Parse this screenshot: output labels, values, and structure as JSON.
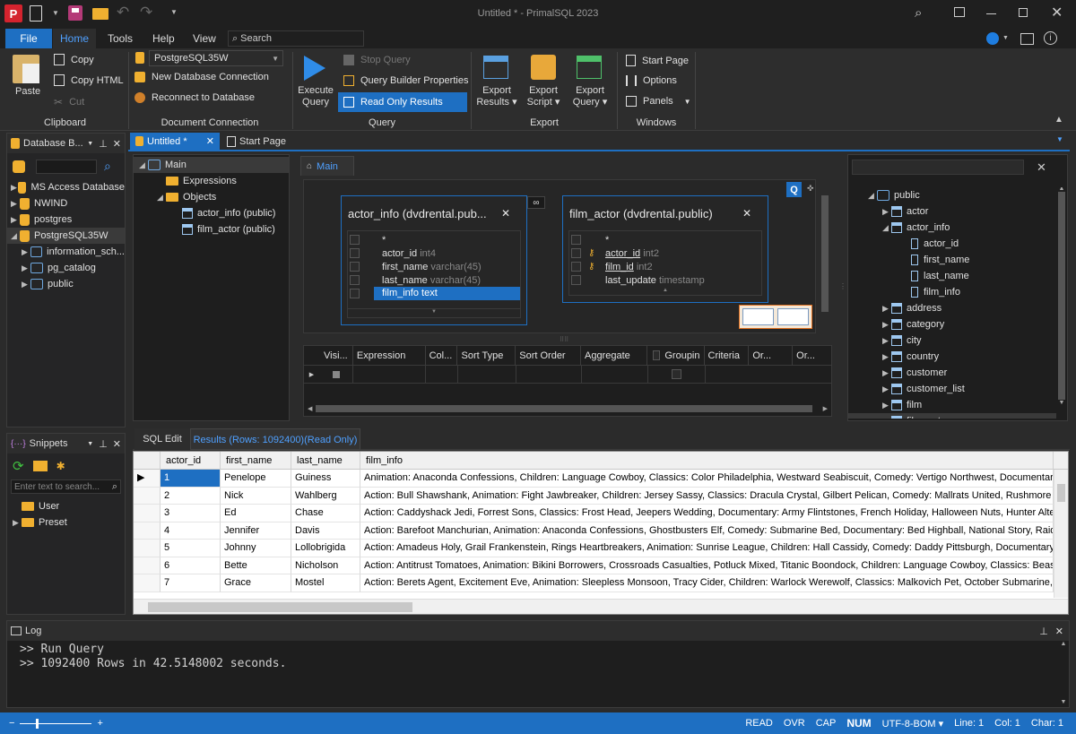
{
  "app": {
    "title": "Untitled * - PrimalSQL 2023"
  },
  "menu": {
    "file": "File",
    "home": "Home",
    "tools": "Tools",
    "help": "Help",
    "view": "View",
    "search_placeholder": "Search"
  },
  "ribbon": {
    "paste": "Paste",
    "copy": "Copy",
    "copy_html": "Copy HTML",
    "cut": "Cut",
    "clipboard": "Clipboard",
    "connection_select": "PostgreSQL35W",
    "new_connection": "New Database Connection",
    "reconnect": "Reconnect to Database",
    "doc_connection": "Document Connection",
    "execute_line1": "Execute",
    "execute_line2": "Query",
    "stop_query": "Stop Query",
    "qb_properties": "Query Builder Properties",
    "read_only": "Read Only Results",
    "query": "Query",
    "export_results_1": "Export",
    "export_results_2": "Results",
    "export_script_1": "Export",
    "export_script_2": "Script",
    "export_query_1": "Export",
    "export_query_2": "Query",
    "export": "Export",
    "start_page": "Start Page",
    "options": "Options",
    "panels": "Panels",
    "windows": "Windows"
  },
  "db_browser": {
    "title": "Database B...",
    "items": [
      {
        "label": "MS Access Database"
      },
      {
        "label": "NWIND"
      },
      {
        "label": "postgres"
      },
      {
        "label": "PostgreSQL35W"
      },
      {
        "label": "information_sch..."
      },
      {
        "label": "pg_catalog"
      },
      {
        "label": "public"
      }
    ]
  },
  "snippets": {
    "title": "Snippets",
    "filter_placeholder": "Enter text to search...",
    "items": [
      {
        "label": "User"
      },
      {
        "label": "Preset"
      }
    ]
  },
  "tabs": {
    "untitled": "Untitled *",
    "start_page": "Start Page"
  },
  "qtree": {
    "main": "Main",
    "expressions": "Expressions",
    "objects": "Objects",
    "obj1": "actor_info (public)",
    "obj2": "film_actor (public)"
  },
  "designer": {
    "main_tab": "Main",
    "table1": {
      "title": "actor_info (dvdrental.pub...",
      "fields": [
        {
          "name": "*",
          "type": ""
        },
        {
          "name": "actor_id",
          "type": "int4"
        },
        {
          "name": "first_name",
          "type": "varchar(45)"
        },
        {
          "name": "last_name",
          "type": "varchar(45)"
        },
        {
          "name": "film_info",
          "type": "text"
        }
      ]
    },
    "table2": {
      "title": "film_actor (dvdrental.public)",
      "fields": [
        {
          "name": "*",
          "type": ""
        },
        {
          "name": "actor_id",
          "type": "int2"
        },
        {
          "name": "film_id",
          "type": "int2"
        },
        {
          "name": "last_update",
          "type": "timestamp"
        }
      ]
    },
    "q_badge": "Q",
    "columns": [
      "Visi...",
      "Expression",
      "Col...",
      "Sort Type",
      "Sort Order",
      "Aggregate",
      "Groupin",
      "Criteria",
      "Or...",
      "Or..."
    ]
  },
  "schema_tree": {
    "schema": "public",
    "items": [
      {
        "label": "actor"
      },
      {
        "label": "actor_info"
      },
      {
        "label": "actor_id"
      },
      {
        "label": "first_name"
      },
      {
        "label": "last_name"
      },
      {
        "label": "film_info"
      },
      {
        "label": "address"
      },
      {
        "label": "category"
      },
      {
        "label": "city"
      },
      {
        "label": "country"
      },
      {
        "label": "customer"
      },
      {
        "label": "customer_list"
      },
      {
        "label": "film"
      },
      {
        "label": "film_actor"
      }
    ]
  },
  "results": {
    "tab_sql": "SQL Edit",
    "tab_results": "Results (Rows: 1092400)(Read Only)",
    "headers": [
      "actor_id",
      "first_name",
      "last_name",
      "film_info"
    ],
    "rows": [
      [
        "1",
        "Penelope",
        "Guiness",
        "Animation: Anaconda Confessions, Children: Language Cowboy, Classics: Color Philadelphia, Westward Seabiscuit, Comedy: Vertigo Northwest, Documentary: Academ"
      ],
      [
        "2",
        "Nick",
        "Wahlberg",
        "Action: Bull Shawshank, Animation: Fight Jawbreaker, Children: Jersey Sassy, Classics: Dracula Crystal, Gilbert Pelican, Comedy: Mallrats United, Rushmore Mermaid, D"
      ],
      [
        "3",
        "Ed",
        "Chase",
        "Action: Caddyshack Jedi, Forrest Sons, Classics: Frost Head, Jeepers Wedding, Documentary: Army Flintstones, French Holiday, Halloween Nuts, Hunter Alter, Wedding A"
      ],
      [
        "4",
        "Jennifer",
        "Davis",
        "Action: Barefoot Manchurian, Animation: Anaconda Confessions, Ghostbusters Elf, Comedy: Submarine Bed, Documentary: Bed Highball, National Story, Raiders Antitrus"
      ],
      [
        "5",
        "Johnny",
        "Lollobrigida",
        "Action: Amadeus Holy, Grail Frankenstein, Rings Heartbreakers, Animation: Sunrise League, Children: Hall Cassidy, Comedy: Daddy Pittsburgh, Documentary: Bonnie Holc"
      ],
      [
        "6",
        "Bette",
        "Nicholson",
        "Action: Antitrust Tomatoes, Animation: Bikini Borrowers, Crossroads Casualties, Potluck Mixed, Titanic Boondock, Children: Language Cowboy, Classics: Beast Hunchbac"
      ],
      [
        "7",
        "Grace",
        "Mostel",
        "Action: Berets Agent, Excitement Eve, Animation: Sleepless Monsoon, Tracy Cider, Children: Warlock Werewolf, Classics: Malkovich Pet, October Submarine, Drama: Dan"
      ]
    ]
  },
  "log": {
    "title": "Log",
    "lines": [
      ">> Run Query",
      ">> 1092400 Rows in 42.5148002 seconds."
    ]
  },
  "status": {
    "read": "READ",
    "ovr": "OVR",
    "cap": "CAP",
    "num": "NUM",
    "encoding": "UTF-8-BOM",
    "line": "Line: 1",
    "col": "Col: 1",
    "char": "Char: 1"
  }
}
